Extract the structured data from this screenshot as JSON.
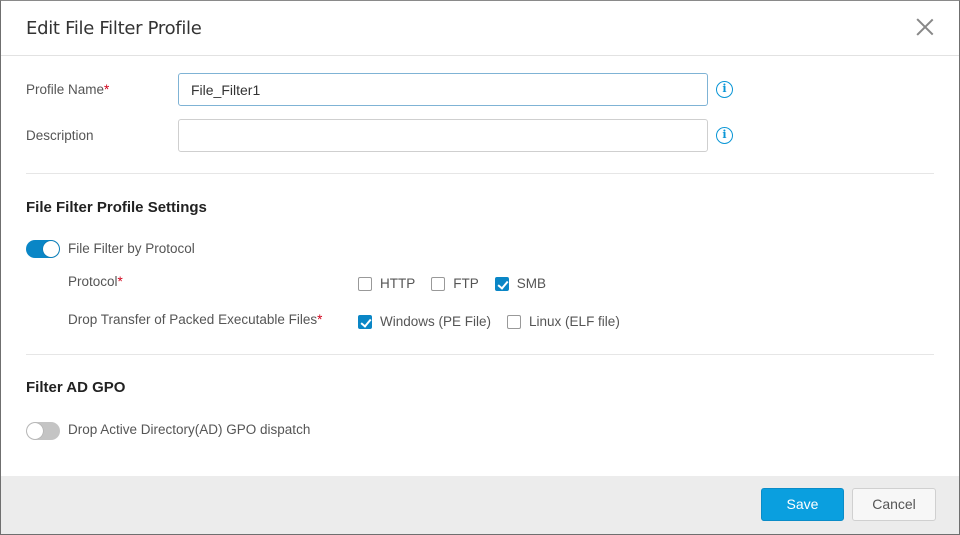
{
  "dialog": {
    "title": "Edit File Filter Profile",
    "close_icon": "close-icon"
  },
  "form": {
    "profile_name": {
      "label": "Profile Name",
      "required_mark": "*",
      "value": "File_Filter1",
      "info_icon": "info-icon"
    },
    "description": {
      "label": "Description",
      "value": "",
      "info_icon": "info-icon"
    }
  },
  "settings": {
    "title": "File Filter Profile Settings",
    "filter_by_protocol": {
      "label": "File Filter by Protocol",
      "enabled": true
    },
    "protocol": {
      "label": "Protocol",
      "required_mark": "*",
      "options": [
        {
          "label": "HTTP",
          "checked": false
        },
        {
          "label": "FTP",
          "checked": false
        },
        {
          "label": "SMB",
          "checked": true
        }
      ]
    },
    "drop_transfer": {
      "label": "Drop Transfer of Packed Executable Files",
      "required_mark": "*",
      "options": [
        {
          "label": "Windows (PE File)",
          "checked": true
        },
        {
          "label": "Linux (ELF file)",
          "checked": false
        }
      ]
    }
  },
  "ad_gpo": {
    "title": "Filter AD GPO",
    "drop_gpo": {
      "label": "Drop Active Directory(AD) GPO dispatch",
      "enabled": false
    }
  },
  "footer": {
    "save_label": "Save",
    "cancel_label": "Cancel"
  },
  "colors": {
    "accent": "#0a86c6",
    "save_button": "#0a9fdf",
    "required": "#d0021b"
  }
}
